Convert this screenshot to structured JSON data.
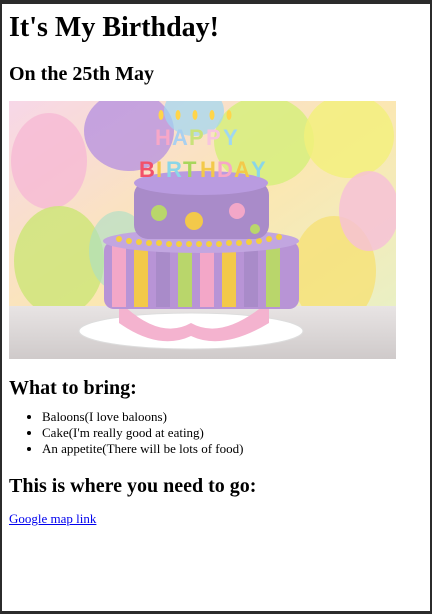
{
  "page": {
    "title": "It's My Birthday!",
    "date_heading": "On the 25th May",
    "image_alt": "Birthday cake with Happy Birthday candles",
    "image_candle_text": "HAPPY BIRTHDAY",
    "bring_heading": "What to bring:",
    "bring_items": [
      "Baloons(I love baloons)",
      "Cake(I'm really good at eating)",
      "An appetite(There will be lots of food)"
    ],
    "go_heading": "This is where you need to go:",
    "map_link_text": "Google map link"
  },
  "colors": {
    "link": "#0000ee",
    "cake_purple": "#a98bc9",
    "cake_pink": "#f2a6c6",
    "cake_yellow": "#f3c94a",
    "cake_green": "#b9d66b"
  }
}
